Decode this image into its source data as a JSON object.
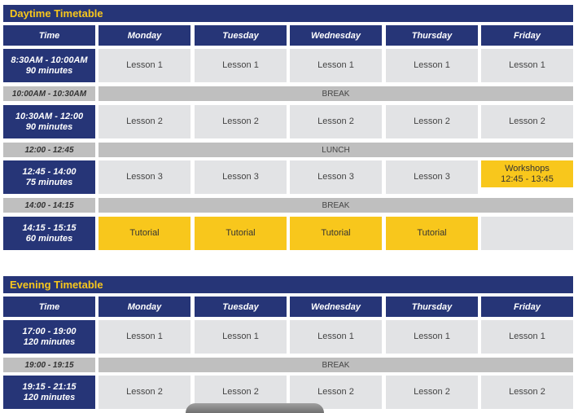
{
  "daytime": {
    "title": "Daytime Timetable",
    "headers": [
      "Time",
      "Monday",
      "Tuesday",
      "Wednesday",
      "Thursday",
      "Friday"
    ],
    "row1": {
      "time": "8:30AM - 10:00AM",
      "duration": "90 minutes",
      "cells": [
        "Lesson 1",
        "Lesson 1",
        "Lesson 1",
        "Lesson 1",
        "Lesson 1"
      ]
    },
    "break1": {
      "time": "10:00AM - 10:30AM",
      "label": "BREAK"
    },
    "row2": {
      "time": "10:30AM - 12:00",
      "duration": "90 minutes",
      "cells": [
        "Lesson 2",
        "Lesson 2",
        "Lesson 2",
        "Lesson 2",
        "Lesson 2"
      ]
    },
    "lunch": {
      "time": "12:00 - 12:45",
      "label": "LUNCH"
    },
    "row3": {
      "time": "12:45 - 14:00",
      "duration": "75 minutes",
      "cells": [
        "Lesson 3",
        "Lesson 3",
        "Lesson 3",
        "Lesson 3"
      ],
      "friday_line1": "Workshops",
      "friday_line2": "12:45 - 13:45"
    },
    "break2": {
      "time": "14:00 - 14:15",
      "label": "BREAK"
    },
    "row4": {
      "time": "14:15 - 15:15",
      "duration": "60 minutes",
      "cells": [
        "Tutorial",
        "Tutorial",
        "Tutorial",
        "Tutorial",
        ""
      ]
    }
  },
  "evening": {
    "title": "Evening Timetable",
    "headers": [
      "Time",
      "Monday",
      "Tuesday",
      "Wednesday",
      "Thursday",
      "Friday"
    ],
    "row1": {
      "time": "17:00 - 19:00",
      "duration": "120 minutes",
      "cells": [
        "Lesson 1",
        "Lesson 1",
        "Lesson 1",
        "Lesson 1",
        "Lesson 1"
      ]
    },
    "break1": {
      "time": "19:00 - 19:15",
      "label": "BREAK"
    },
    "row2": {
      "time": "19:15 - 21:15",
      "duration": "120 minutes",
      "cells": [
        "Lesson 2",
        "Lesson 2",
        "Lesson 2",
        "Lesson 2",
        "Lesson 2"
      ]
    }
  },
  "colors": {
    "navy": "#263577",
    "yellow": "#f8c71c",
    "cell_grey": "#e2e3e5",
    "bar_grey": "#bfbfbf"
  }
}
